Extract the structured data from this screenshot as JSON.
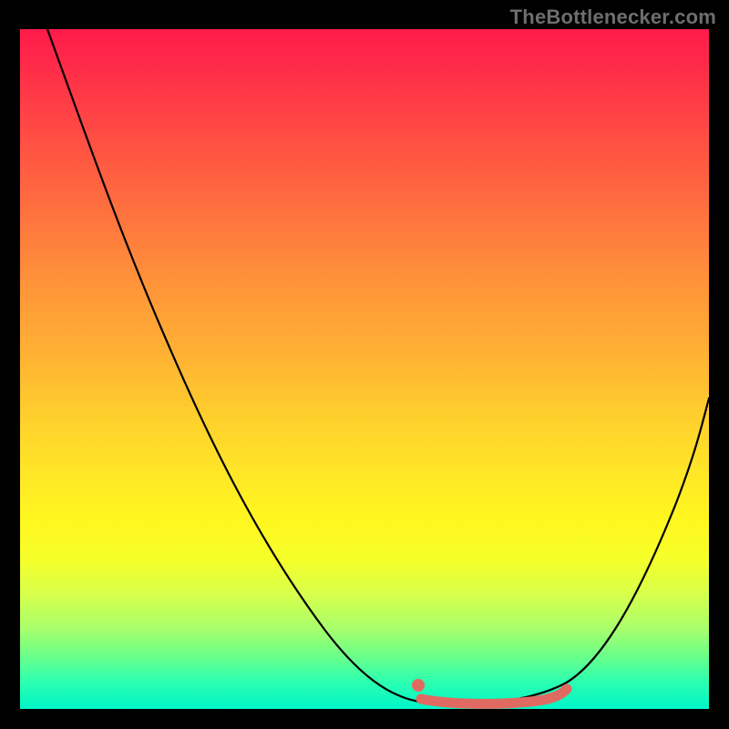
{
  "watermark": "TheBottlenecker.com",
  "colors": {
    "frame": "#000000",
    "gradient_top": "#ff1a4b",
    "gradient_mid": "#ffe826",
    "gradient_bottom": "#00f5c9",
    "curve": "#000000",
    "marker": "#e06a62",
    "watermark": "#6e6e6e"
  },
  "chart_data": {
    "type": "line",
    "title": "",
    "xlabel": "",
    "ylabel": "",
    "xlim": [
      0,
      100
    ],
    "ylim": [
      0,
      100
    ],
    "x": [
      4,
      9,
      15,
      21,
      27,
      33,
      39,
      44,
      50,
      55,
      58,
      63,
      68,
      73,
      79,
      85,
      90,
      95,
      100
    ],
    "values": [
      100,
      85,
      70,
      55,
      42,
      30,
      20,
      11,
      5,
      2,
      1,
      1,
      2,
      4,
      9,
      17,
      27,
      37,
      46
    ],
    "optimal_range_x": [
      58,
      79
    ],
    "background_gradient": {
      "orientation": "vertical",
      "stops": [
        {
          "pos": 0.0,
          "color": "#ff1a4b"
        },
        {
          "pos": 0.36,
          "color": "#ff8f3a"
        },
        {
          "pos": 0.66,
          "color": "#ffe826"
        },
        {
          "pos": 0.88,
          "color": "#aaff6a"
        },
        {
          "pos": 1.0,
          "color": "#00f5c9"
        }
      ]
    }
  }
}
